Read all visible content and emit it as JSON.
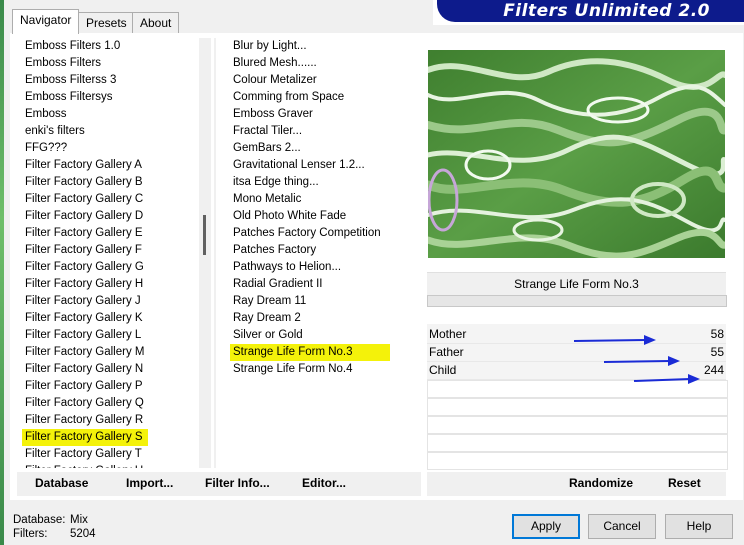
{
  "tabs": [
    "Navigator",
    "Presets",
    "About"
  ],
  "banner_title": "Filters Unlimited 2.0",
  "categories": [
    "Emboss Filters 1.0",
    "Emboss Filters",
    "Emboss Filterss 3",
    "Emboss Filtersys",
    "Emboss",
    "enki's filters",
    "FFG???",
    "Filter Factory Gallery A",
    "Filter Factory Gallery B",
    "Filter Factory Gallery C",
    "Filter Factory Gallery D",
    "Filter Factory Gallery E",
    "Filter Factory Gallery F",
    "Filter Factory Gallery G",
    "Filter Factory Gallery H",
    "Filter Factory Gallery J",
    "Filter Factory Gallery K",
    "Filter Factory Gallery L",
    "Filter Factory Gallery M",
    "Filter Factory Gallery N",
    "Filter Factory Gallery P",
    "Filter Factory Gallery Q",
    "Filter Factory Gallery R",
    "Filter Factory Gallery S",
    "Filter Factory Gallery T",
    "Filter Factory Gallery U"
  ],
  "selected_category": "Filter Factory Gallery S",
  "filters": [
    "Blur by Light...",
    "Blured Mesh......",
    "Colour Metalizer",
    "Comming from Space",
    "Emboss Graver",
    "Fractal Tiler...",
    "GemBars 2...",
    "Gravitational Lenser 1.2...",
    "itsa Edge thing...",
    "Mono Metalic",
    "Old Photo White Fade",
    "Patches Factory Competition",
    "Patches Factory",
    "Pathways to Helion...",
    "Radial Gradient II",
    "Ray Dream 11",
    "Ray Dream 2",
    "Silver or Gold",
    "Strange Life Form No.3",
    "Strange Life Form No.4"
  ],
  "selected_filter": "Strange Life Form No.3",
  "filter_title": "Strange Life Form No.3",
  "params": [
    {
      "label": "Mother",
      "value": "58"
    },
    {
      "label": "Father",
      "value": "55"
    },
    {
      "label": "Child",
      "value": "244"
    }
  ],
  "toolbar": {
    "database": "Database",
    "import": "Import...",
    "filter_info": "Filter Info...",
    "editor": "Editor...",
    "randomize": "Randomize",
    "reset": "Reset"
  },
  "status": {
    "database_label": "Database:",
    "database_value": "Mix",
    "filters_label": "Filters:",
    "filters_value": "5204"
  },
  "buttons": {
    "apply": "Apply",
    "cancel": "Cancel",
    "help": "Help"
  },
  "colors": {
    "highlight": "#f4f20a",
    "banner": "#0d1b8c",
    "arrow": "#1a2bd6"
  }
}
